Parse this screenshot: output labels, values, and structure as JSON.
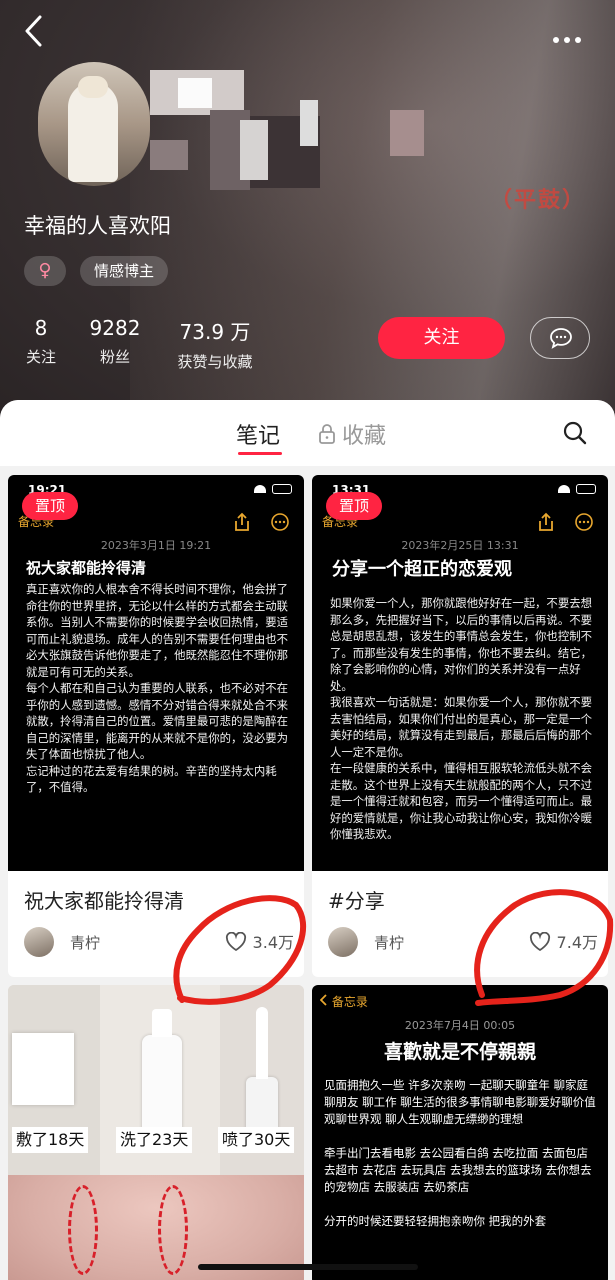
{
  "nav": {
    "back": "<",
    "more": "more"
  },
  "profile": {
    "name": "幸福的人喜欢阳",
    "gender": "♀",
    "category": "情感博主",
    "stamp": "（平鼓）",
    "stats": [
      {
        "value": "8",
        "label": "关注"
      },
      {
        "value": "9282",
        "label": "粉丝"
      },
      {
        "value": "73.9 万",
        "label": "获赞与收藏"
      }
    ],
    "follow_label": "关注"
  },
  "tabs": {
    "notes": "笔记",
    "favorites": "收藏"
  },
  "cards": [
    {
      "pin": "置顶",
      "time": "19:21",
      "memo": "备忘录",
      "date": "2023年3月1日 19:21",
      "heading": "祝大家都能拎得清",
      "body": "真正喜欢你的人根本舍不得长时间不理你，他会拼了命往你的世界里挤，无论以什么样的方式都会主动联系你。当别人不需要你的时候要学会收回热情，要适可而止礼貌退场。成年人的告别不需要任何理由也不必大张旗鼓告诉他你要走了，他既然能忍住不理你那就是可有可无的关系。\n每个人都在和自己认为重要的人联系，也不必对不在乎你的人感到遗憾。感情不分对错合得来就处合不来就散，拎得清自己的位置。爱情里最可悲的是陶醉在自己的深情里，能离开的从来就不是你的，没必要为失了体面也惊扰了他人。\n忘记种过的花去爱有结果的树。辛苦的坚持太内耗了，不值得。",
      "title": "祝大家都能拎得清",
      "author": "青柠",
      "likes": "3.4万"
    },
    {
      "pin": "置顶",
      "time": "13:31",
      "memo": "备忘录",
      "date": "2023年2月25日 13:31",
      "heading": "分享一个超正的恋爱观",
      "body": "如果你爱一个人，那你就跟他好好在一起，不要去想那么多，先把握好当下，以后的事情以后再说。不要总是胡思乱想，该发生的事情总会发生，你也控制不了。而那些没有发生的事情，你也不要去纠。结它，除了会影响你的心情，对你们的关系并没有一点好处。\n我很喜欢一句话就是：如果你爱一个人，那你就不要去害怕结局，如果你们付出的是真心，那一定是一个美好的结局，就算没有走到最后，那最后后悔的那个人一定不是你。\n在一段健康的关系中，懂得相互服软轮流低头就不会走散。这个世界上没有天生就般配的两个人，只不过是一个懂得迁就和包容，而另一个懂得适可而止。最好的爱情就是，你让我心动我让你心安，我知你冷暖你懂我悲欢。",
      "title": "#分享",
      "author": "青柠",
      "likes": "7.4万"
    }
  ],
  "product_card": {
    "labels": [
      "敷了18天",
      "洗了23天",
      "喷了30天"
    ]
  },
  "memo_card": {
    "back": "备忘录",
    "date": "2023年7月4日 00:05",
    "heading": "喜歡就是不停親親",
    "body": "见面拥抱久一些 许多次亲吻 一起聊天聊童年 聊家庭 聊朋友 聊工作 聊生活的很多事情聊电影聊爱好聊价值观聊世界观 聊人生观聊虚无缥缈的理想\n\n牵手出门去看电影 去公园看白鸽 去吃拉面 去面包店 去超市 去花店 去玩具店 去我想去的篮球场 去你想去的宠物店 去服装店 去奶茶店\n\n分开的时候还要轻轻拥抱亲吻你 把我的外套"
  },
  "colors": {
    "accent": "#ff2442",
    "memo_yellow": "#e8a72f",
    "scribble": "#e5231b"
  }
}
